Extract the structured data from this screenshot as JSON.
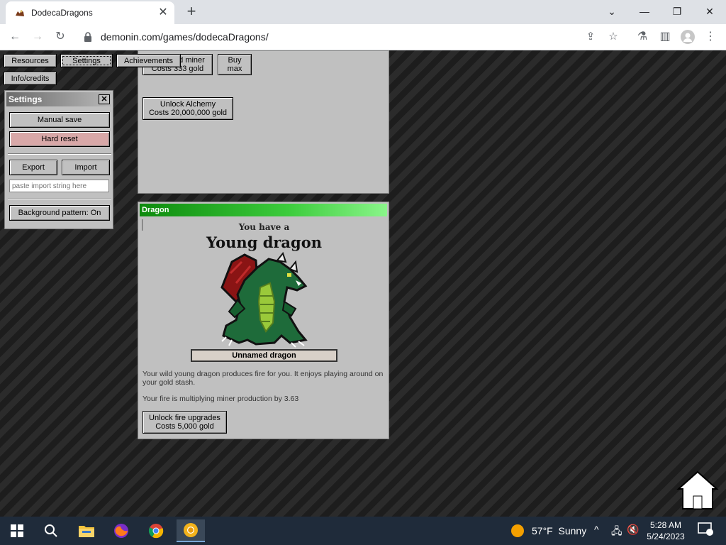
{
  "browser": {
    "tab_title": "DodecaDragons",
    "url": "demonin.com/games/dodecaDragons/"
  },
  "nav": {
    "resources": "Resources",
    "settings": "Settings",
    "achievements": "Achievements",
    "info": "Info/credits"
  },
  "shop": {
    "hidden_miner_line1": "d miner",
    "hidden_miner_line2": "Costs 333 gold",
    "buy_max_line1": "Buy",
    "buy_max_line2": "max",
    "alchemy_line1": "Unlock Alchemy",
    "alchemy_line2": "Costs 20,000,000 gold"
  },
  "settings": {
    "title": "Settings",
    "manual_save": "Manual save",
    "hard_reset": "Hard reset",
    "export": "Export",
    "import": "Import",
    "import_placeholder": "paste import string here",
    "background_pattern": "Background pattern: On"
  },
  "dragon": {
    "panel_title": "Dragon",
    "you_have": "You have a",
    "stage": "Young dragon",
    "name": "Unnamed dragon",
    "description": "Your wild young dragon produces fire for you. It enjoys playing around on your gold stash.",
    "multiplier_text": "Your fire is multiplying miner production by 3.63",
    "fire_upgrades_line1": "Unlock fire upgrades",
    "fire_upgrades_line2": "Costs 5,000 gold"
  },
  "taskbar": {
    "weather_temp": "57°F",
    "weather_cond": "Sunny",
    "time": "5:28 AM",
    "date": "5/24/2023"
  },
  "colors": {
    "hard_reset_bg": "#d8a8a8",
    "dragon_title_green": "#3ccc3c"
  }
}
